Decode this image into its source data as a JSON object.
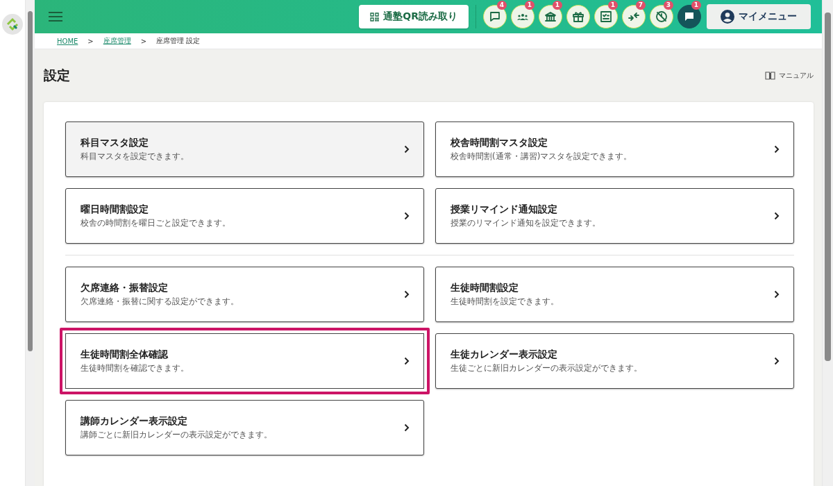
{
  "header": {
    "qr_button": "通塾QR読み取り",
    "icon_buttons": [
      {
        "kind": "chat",
        "badge": "4",
        "selected": false
      },
      {
        "kind": "group",
        "badge": "1",
        "selected": false
      },
      {
        "kind": "building",
        "badge": "1",
        "selected": false
      },
      {
        "kind": "gift",
        "selected": false
      },
      {
        "kind": "checklist",
        "badge": "1",
        "selected": false
      },
      {
        "kind": "arrows",
        "badge": "7",
        "selected": false
      },
      {
        "kind": "no-location",
        "badge": "3",
        "selected": false
      },
      {
        "kind": "message",
        "badge": "1",
        "selected": true
      }
    ],
    "my_menu": "マイメニュー"
  },
  "breadcrumb": [
    {
      "label": "HOME",
      "link": true
    },
    {
      "label": "座席管理",
      "link": true
    },
    {
      "label": "座席管理 設定",
      "link": false
    }
  ],
  "breadcrumb_separator": ">",
  "page": {
    "title": "設定",
    "manual_link": "マニュアル"
  },
  "card_groups": [
    [
      {
        "title": "科目マスタ設定",
        "description": "科目マスタを設定できます。",
        "highlighted": false,
        "hovered": true
      },
      {
        "title": "校舎時間割マスタ設定",
        "description": "校舎時間割(通常・講習)マスタを設定できます。",
        "highlighted": false,
        "hovered": false
      },
      {
        "title": "曜日時間割設定",
        "description": "校舎の時間割を曜日ごと設定できます。",
        "highlighted": false,
        "hovered": false
      },
      {
        "title": "授業リマインド通知設定",
        "description": "授業のリマインド通知を設定できます。",
        "highlighted": false,
        "hovered": false
      }
    ],
    [
      {
        "title": "欠席連絡・振替設定",
        "description": "欠席連絡・振替に関する設定ができます。",
        "highlighted": false,
        "hovered": false
      },
      {
        "title": "生徒時間割設定",
        "description": "生徒時間割を設定できます。",
        "highlighted": false,
        "hovered": false
      },
      {
        "title": "生徒時間割全体確認",
        "description": "生徒時間割を確認できます。",
        "highlighted": true,
        "hovered": false
      },
      {
        "title": "生徒カレンダー表示設定",
        "description": "生徒ごとに新旧カレンダーの表示設定ができます。",
        "highlighted": false,
        "hovered": false
      },
      {
        "title": "講師カレンダー表示設定",
        "description": "講師ごとに新旧カレンダーの表示設定ができます。",
        "highlighted": false,
        "hovered": false
      }
    ]
  ]
}
